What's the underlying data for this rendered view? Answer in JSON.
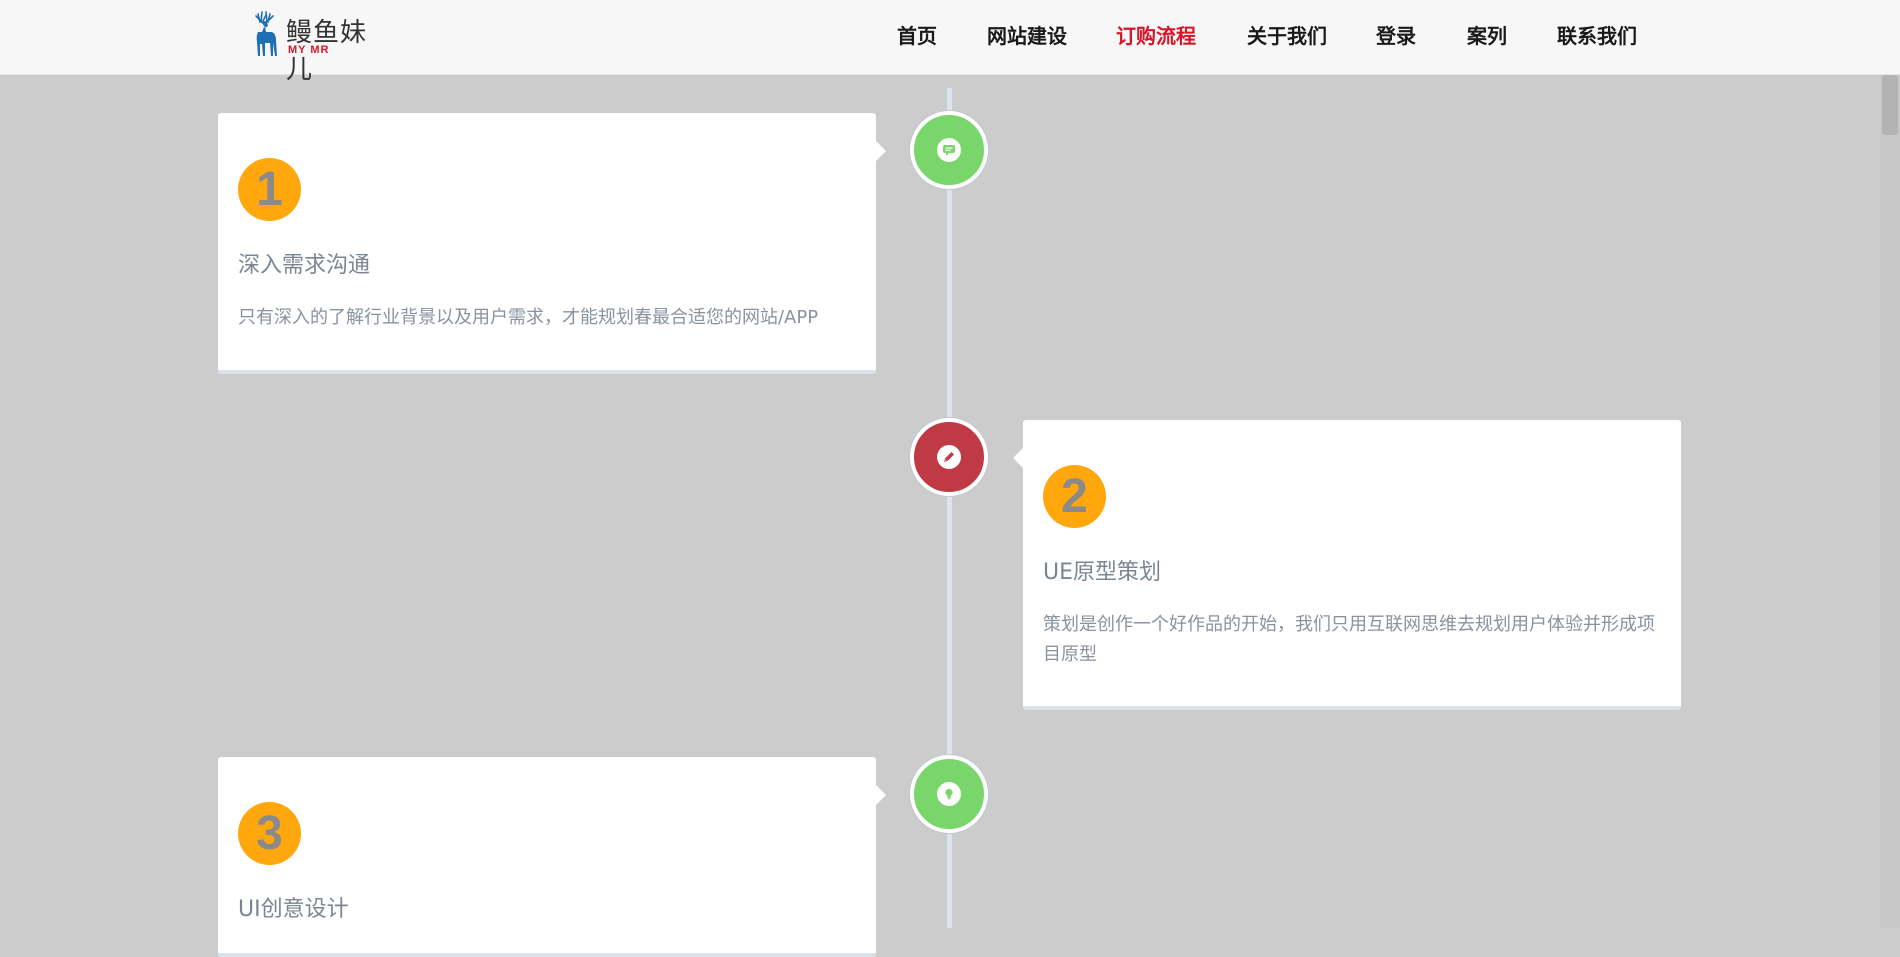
{
  "brand": {
    "name_cn": "鳗鱼妹儿",
    "name_en": "MY MR",
    "logo_icon": "deer-icon"
  },
  "nav": {
    "items": [
      {
        "label": "首页",
        "active": false
      },
      {
        "label": "网站建设",
        "active": false
      },
      {
        "label": "订购流程",
        "active": true
      },
      {
        "label": "关于我们",
        "active": false
      },
      {
        "label": "登录",
        "active": false
      },
      {
        "label": "案列",
        "active": false
      },
      {
        "label": "联系我们",
        "active": false
      }
    ]
  },
  "colors": {
    "background": "#cccccc",
    "header": "#f7f7f7",
    "accent_red": "#d6172a",
    "badge": "#ffa70c",
    "circle_green": "#79d66b",
    "circle_red": "#c03a45"
  },
  "steps": [
    {
      "number": "1",
      "title": "深入需求沟通",
      "description": "只有深入的了解行业背景以及用户需求，才能规划春最合适您的网站/APP",
      "icon": "chat-icon",
      "side": "left"
    },
    {
      "number": "2",
      "title": "UE原型策划",
      "description": "策划是创作一个好作品的开始，我们只用互联网思维去规划用户体验并形成项目原型",
      "icon": "pencil-icon",
      "side": "right"
    },
    {
      "number": "3",
      "title": "UI创意设计",
      "description": "",
      "icon": "lightbulb-icon",
      "side": "left"
    }
  ]
}
